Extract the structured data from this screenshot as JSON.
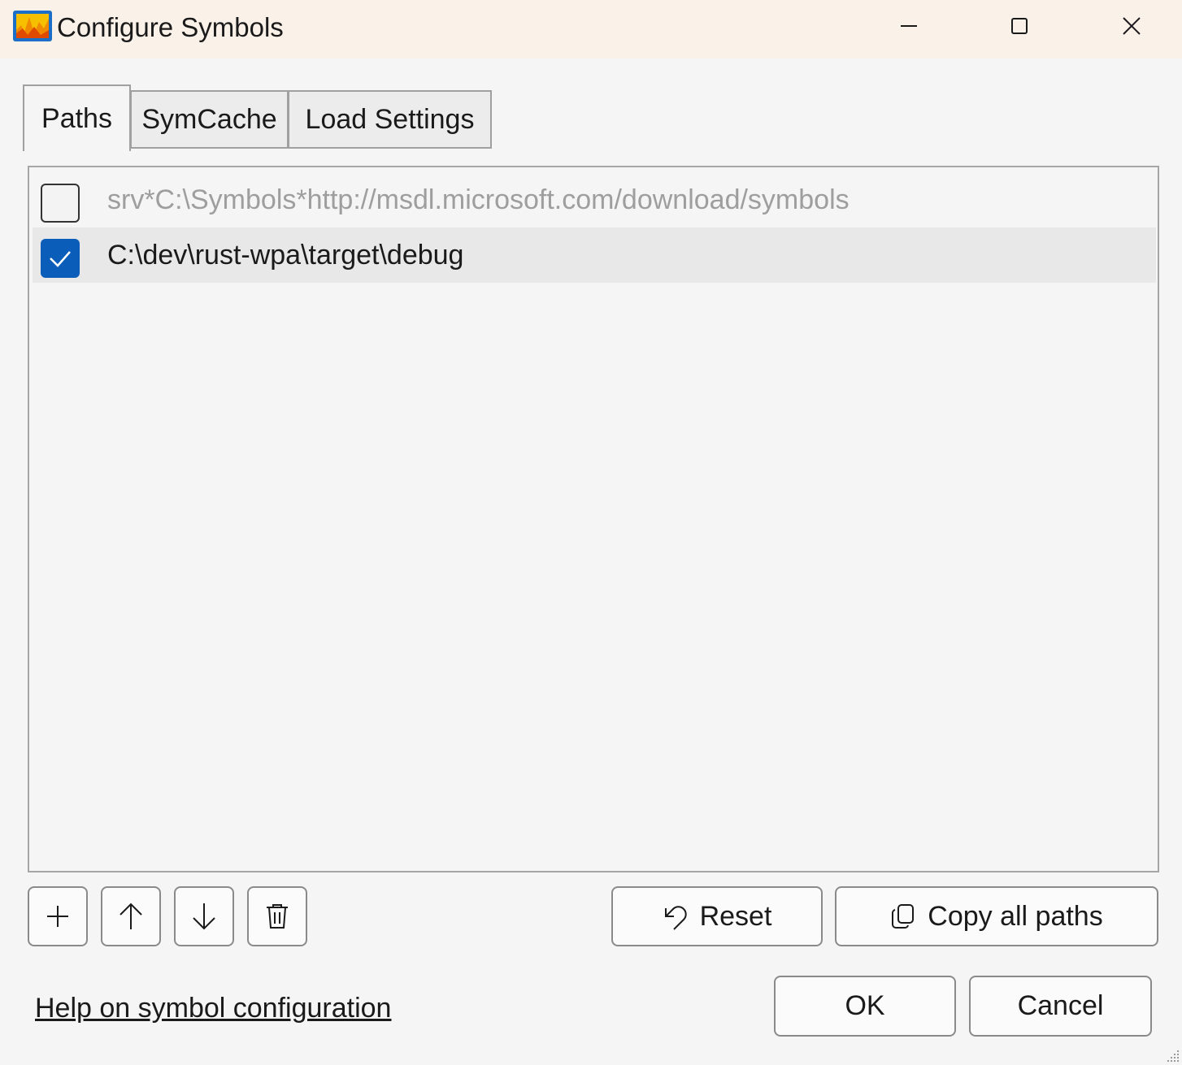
{
  "window": {
    "title": "Configure Symbols",
    "controls": [
      "minimize-icon",
      "maximize-icon",
      "close-icon"
    ]
  },
  "tabs": [
    {
      "label": "Paths",
      "active": true
    },
    {
      "label": "SymCache",
      "active": false
    },
    {
      "label": "Load Settings",
      "active": false
    }
  ],
  "paths": [
    {
      "text": "srv*C:\\Symbols*http://msdl.microsoft.com/download/symbols",
      "checked": false,
      "enabled": false
    },
    {
      "text": "C:\\dev\\rust-wpa\\target\\debug",
      "checked": true,
      "enabled": true
    }
  ],
  "toolbar": {
    "icons": [
      "add-icon",
      "move-up-icon",
      "move-down-icon",
      "delete-icon"
    ],
    "reset_label": "Reset",
    "copy_label": "Copy all paths"
  },
  "footer": {
    "help_link": "Help on symbol configuration",
    "ok_label": "OK",
    "cancel_label": "Cancel"
  },
  "colors": {
    "titlebar": "#faf1e8",
    "accent": "#0a5eba",
    "window_bg": "#f5f5f5"
  }
}
